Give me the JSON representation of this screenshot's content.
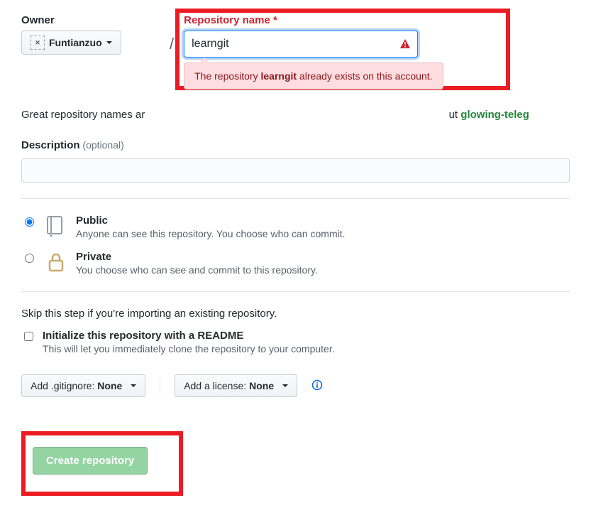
{
  "owner": {
    "label": "Owner",
    "username": "Funtianzuo",
    "avatar_alt": "avatar"
  },
  "repo": {
    "label": "Repository name",
    "required_star": "*",
    "value": "learngit",
    "error_pre": "The repository ",
    "error_name": "learngit",
    "error_post": " already exists on this account."
  },
  "hint": {
    "pre": "Great repository names ar",
    "mid": "ut ",
    "suggest": "glowing-teleg"
  },
  "description": {
    "label": "Description",
    "optional": "(optional)",
    "value": ""
  },
  "visibility": {
    "public": {
      "title": "Public",
      "sub": "Anyone can see this repository. You choose who can commit."
    },
    "private": {
      "title": "Private",
      "sub": "You choose who can see and commit to this repository."
    }
  },
  "init": {
    "skip": "Skip this step if you're importing an existing repository.",
    "readme_title": "Initialize this repository with a README",
    "readme_sub": "This will let you immediately clone the repository to your computer."
  },
  "selectors": {
    "gitignore_pre": "Add .gitignore: ",
    "gitignore_val": "None",
    "license_pre": "Add a license: ",
    "license_val": "None"
  },
  "create_label": "Create repository"
}
